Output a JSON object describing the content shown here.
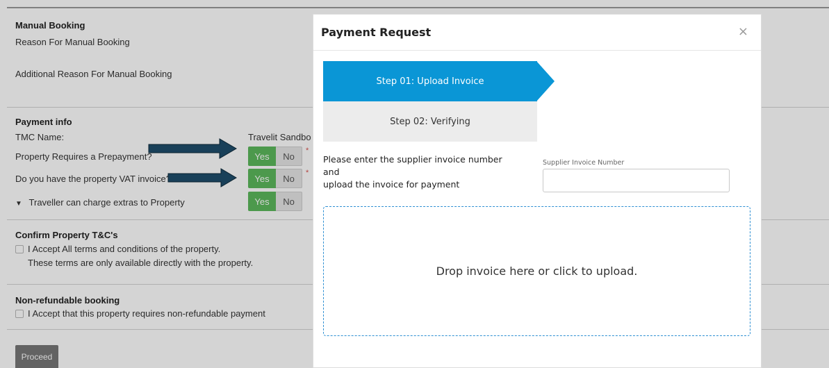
{
  "page": {
    "manual_booking": {
      "title": "Manual Booking",
      "reason_label": "Reason For Manual Booking",
      "additional_reason_label": "Additional Reason For Manual Booking"
    },
    "payment_info": {
      "title": "Payment info",
      "tmc_label": "TMC Name:",
      "tmc_value": "Travelit Sandbo",
      "prepayment_label": "Property Requires a Prepayment?",
      "vat_label": "Do you have the property VAT invoice?",
      "extras_label": "Traveller can charge extras to Property",
      "yes": "Yes",
      "no": "No",
      "required_mark": "*"
    },
    "terms": {
      "title": "Confirm Property T&C's",
      "accept": "I Accept All terms and conditions of the property.",
      "note": "These terms are only available directly with the property."
    },
    "nonrefundable": {
      "title": "Non-refundable booking",
      "accept": "I Accept that this property requires non-refundable payment"
    },
    "proceed": "Proceed"
  },
  "modal": {
    "title": "Payment Request",
    "close": "×",
    "step1": "Step 01: Upload Invoice",
    "step2": "Step 02: Verifying",
    "instruction_line1": "Please enter the supplier invoice number",
    "instruction_line2": "and",
    "instruction_line3": "upload the invoice for payment",
    "invoice_label": "Supplier Invoice Number",
    "invoice_value": "",
    "dropzone_text": "Drop invoice here or click to upload."
  },
  "colors": {
    "step_active": "#0a96d6",
    "yes_green": "#5cb85c",
    "arrow": "#1f4e6b",
    "dropzone_border": "#2d8fd3"
  }
}
